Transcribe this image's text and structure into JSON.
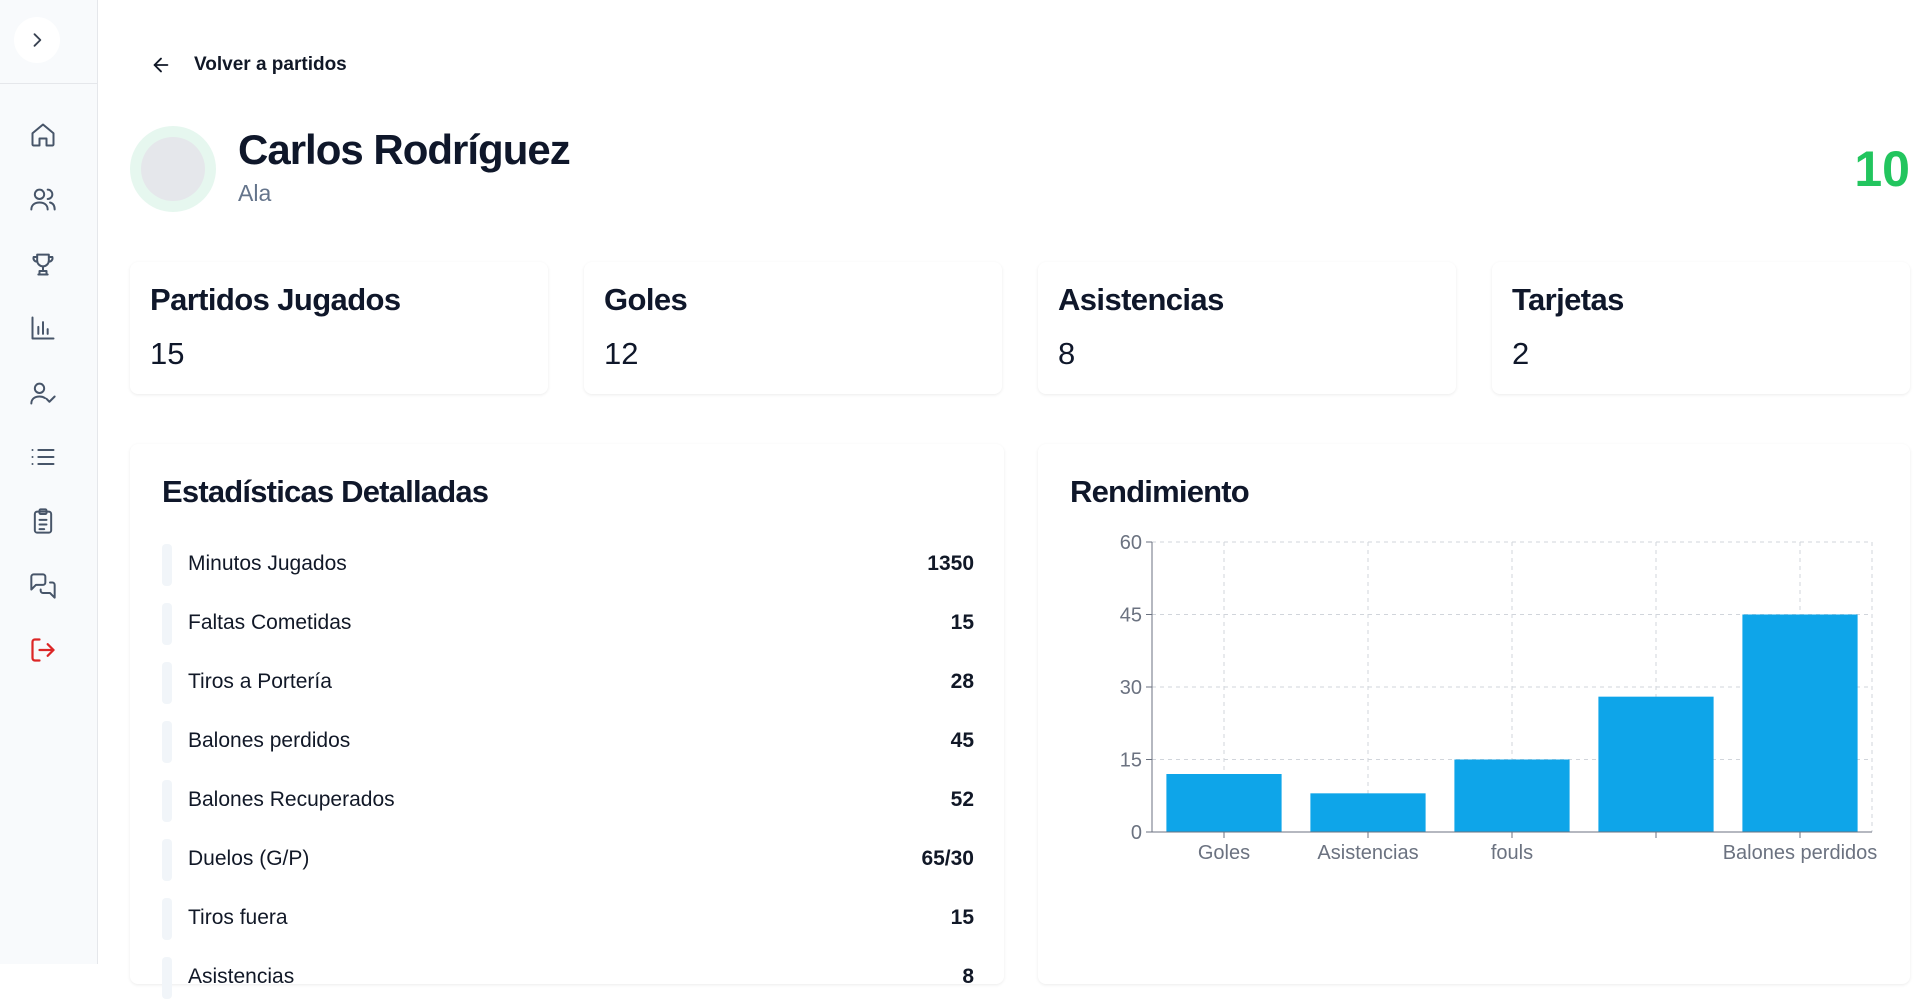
{
  "sidebar": {
    "toggle_icon": "chevron-right-icon",
    "items": [
      {
        "name": "home",
        "icon": "home-icon"
      },
      {
        "name": "players",
        "icon": "users-icon"
      },
      {
        "name": "trophies",
        "icon": "trophy-icon"
      },
      {
        "name": "stats",
        "icon": "bar-chart-icon"
      },
      {
        "name": "attendance",
        "icon": "user-check-icon"
      },
      {
        "name": "list",
        "icon": "list-icon"
      },
      {
        "name": "clipboard",
        "icon": "clipboard-icon"
      },
      {
        "name": "messages",
        "icon": "messages-icon"
      },
      {
        "name": "logout",
        "icon": "logout-icon",
        "color": "#dc2626"
      }
    ]
  },
  "header": {
    "back_label": "Volver a partidos",
    "player_name": "Carlos Rodríguez",
    "position": "Ala",
    "number": "10",
    "number_color": "#22c55e"
  },
  "summary": [
    {
      "label": "Partidos Jugados",
      "value": "15"
    },
    {
      "label": "Goles",
      "value": "12"
    },
    {
      "label": "Asistencias",
      "value": "8"
    },
    {
      "label": "Tarjetas",
      "value": "2"
    }
  ],
  "details": {
    "title": "Estadísticas Detalladas",
    "rows": [
      {
        "name": "Minutos Jugados",
        "value": "1350"
      },
      {
        "name": "Faltas Cometidas",
        "value": "15"
      },
      {
        "name": "Tiros a Portería",
        "value": "28"
      },
      {
        "name": "Balones perdidos",
        "value": "45"
      },
      {
        "name": "Balones Recuperados",
        "value": "52"
      },
      {
        "name": "Duelos (G/P)",
        "value": "65/30"
      },
      {
        "name": "Tiros fuera",
        "value": "15"
      },
      {
        "name": "Asistencias",
        "value": "8"
      }
    ]
  },
  "performance": {
    "title": "Rendimiento"
  },
  "chart_data": {
    "type": "bar",
    "categories": [
      "Goles",
      "Asistencias",
      "fouls",
      "",
      "Balones perdidos"
    ],
    "values": [
      12,
      8,
      15,
      28,
      45
    ],
    "ylim": [
      0,
      60
    ],
    "yticks": [
      0,
      15,
      30,
      45,
      60
    ],
    "grid": true,
    "bar_color": "#0ea5e9"
  }
}
